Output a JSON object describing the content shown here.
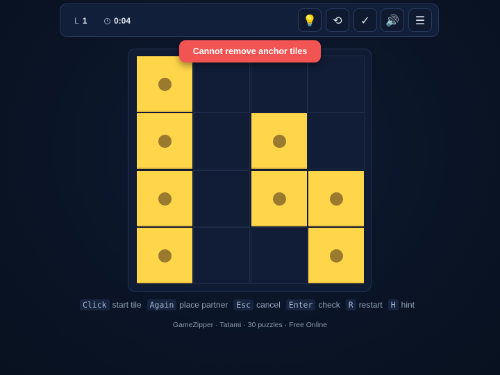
{
  "toolbar": {
    "level_label": "L",
    "level_value": "1",
    "timer_value": "0:04",
    "buttons": {
      "hint": "💡",
      "undo": "⟲",
      "check": "✓",
      "sound": "🔊",
      "menu": "☰"
    }
  },
  "toast": {
    "message": "Cannot remove anchor tiles",
    "color": "#f25353"
  },
  "board": {
    "rows": 4,
    "cols": 4,
    "tile_color": "#ffd54a",
    "anchor_color": "#9a7a2e",
    "filled_cells": [
      {
        "row": 0,
        "col": 0,
        "anchor": true
      },
      {
        "row": 1,
        "col": 0,
        "anchor": true
      },
      {
        "row": 1,
        "col": 2,
        "anchor": true
      },
      {
        "row": 2,
        "col": 0,
        "anchor": true
      },
      {
        "row": 2,
        "col": 2,
        "anchor": true
      },
      {
        "row": 2,
        "col": 3,
        "anchor": true
      },
      {
        "row": 3,
        "col": 0,
        "anchor": true
      },
      {
        "row": 3,
        "col": 3,
        "anchor": true
      }
    ]
  },
  "hints": [
    {
      "key": "Click",
      "text": "start tile"
    },
    {
      "key": "Again",
      "text": "place partner"
    },
    {
      "key": "Esc",
      "text": "cancel"
    },
    {
      "key": "Enter",
      "text": "check"
    },
    {
      "key": "R",
      "text": "restart"
    },
    {
      "key": "H",
      "text": "hint"
    }
  ],
  "footer": "GameZipper · Tatami · 30 puzzles · Free Online"
}
